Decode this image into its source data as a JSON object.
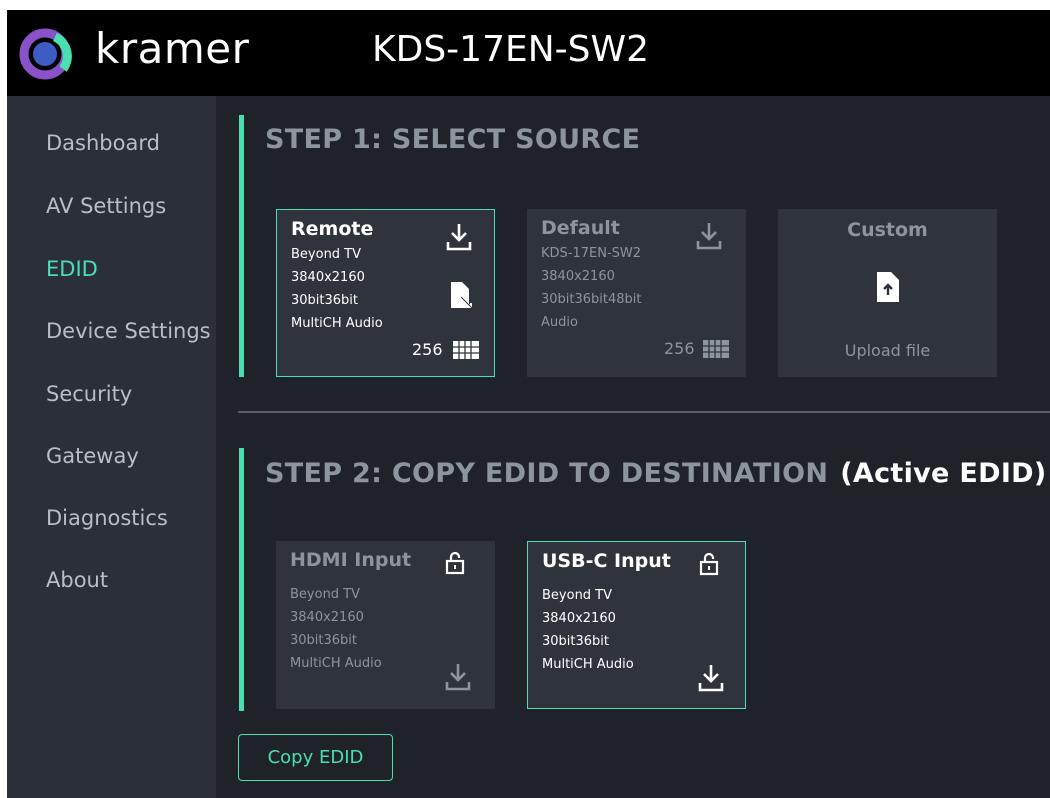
{
  "header": {
    "brand": "kramer",
    "device_name": "KDS-17EN-SW2"
  },
  "colors": {
    "accent": "#49dfb0",
    "header_bg": "#000000",
    "sidebar_bg": "#2b3038",
    "main_bg": "#1f2329",
    "card_bg": "#2f343c"
  },
  "sidebar": {
    "items": [
      {
        "label": "Dashboard",
        "active": false
      },
      {
        "label": "AV Settings",
        "active": false
      },
      {
        "label": "EDID",
        "active": true
      },
      {
        "label": "Device Settings",
        "active": false
      },
      {
        "label": "Security",
        "active": false
      },
      {
        "label": "Gateway",
        "active": false
      },
      {
        "label": "Diagnostics",
        "active": false
      },
      {
        "label": "About",
        "active": false
      }
    ]
  },
  "step1": {
    "title": "STEP 1: SELECT SOURCE",
    "sources": [
      {
        "title": "Remote",
        "lines": [
          "Beyond TV",
          "3840x2160",
          "30bit36bit",
          "MultiCH Audio"
        ],
        "count": "256",
        "selected": true,
        "icons": [
          "download-icon",
          "file-remote-icon",
          "grid-icon"
        ]
      },
      {
        "title": "Default",
        "lines": [
          "KDS-17EN-SW2",
          "3840x2160",
          "30bit36bit48bit",
          "Audio"
        ],
        "count": "256",
        "selected": false,
        "icons": [
          "download-icon",
          "grid-icon"
        ]
      },
      {
        "title": "Custom",
        "upload_label": "Upload file",
        "selected": false,
        "icons": [
          "file-upload-icon"
        ]
      }
    ]
  },
  "step2": {
    "title": "STEP 2: COPY EDID TO DESTINATION",
    "active_label": "(Active EDID)",
    "destinations": [
      {
        "title": "HDMI Input",
        "lines": [
          "Beyond TV",
          "3840x2160",
          "30bit36bit",
          "MultiCH Audio"
        ],
        "selected": false,
        "icons": [
          "lock-icon",
          "download-icon"
        ]
      },
      {
        "title": "USB-C Input",
        "lines": [
          "Beyond TV",
          "3840x2160",
          "30bit36bit",
          "MultiCH Audio"
        ],
        "selected": true,
        "icons": [
          "lock-icon",
          "download-icon"
        ]
      }
    ]
  },
  "actions": {
    "copy_label": "Copy EDID"
  }
}
